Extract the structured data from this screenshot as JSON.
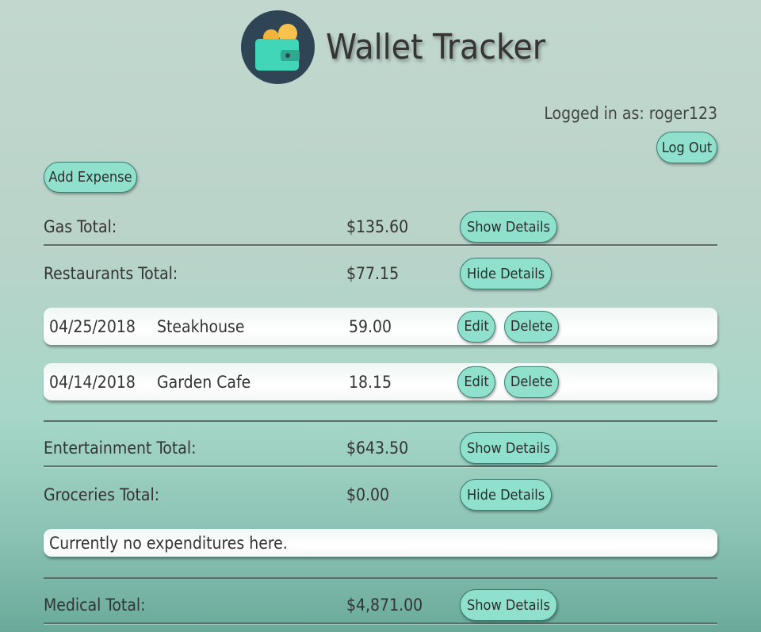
{
  "app": {
    "title": "Wallet Tracker"
  },
  "session": {
    "logged_in_text": "Logged in as: roger123",
    "logout_label": "Log Out"
  },
  "actions": {
    "add_expense_label": "Add Expense"
  },
  "categories": [
    {
      "name": "Gas Total:",
      "total": "$135.60",
      "toggle_label": "Show Details"
    },
    {
      "name": "Restaurants Total:",
      "total": "$77.15",
      "toggle_label": "Hide Details",
      "expenses": [
        {
          "date": "04/25/2018",
          "description": "Steakhouse",
          "amount": "59.00",
          "edit_label": "Edit",
          "delete_label": "Delete"
        },
        {
          "date": "04/14/2018",
          "description": "Garden Cafe",
          "amount": "18.15",
          "edit_label": "Edit",
          "delete_label": "Delete"
        }
      ]
    },
    {
      "name": "Entertainment Total:",
      "total": "$643.50",
      "toggle_label": "Show Details"
    },
    {
      "name": "Groceries Total:",
      "total": "$0.00",
      "toggle_label": "Hide Details",
      "empty_message": "Currently no expenditures here."
    },
    {
      "name": "Medical Total:",
      "total": "$4,871.00",
      "toggle_label": "Show Details"
    }
  ],
  "colors": {
    "button_fill": "#8fe0cc",
    "logo_bg": "#2f4556",
    "wallet": "#42d6b8",
    "coin": "#f3b33c"
  }
}
